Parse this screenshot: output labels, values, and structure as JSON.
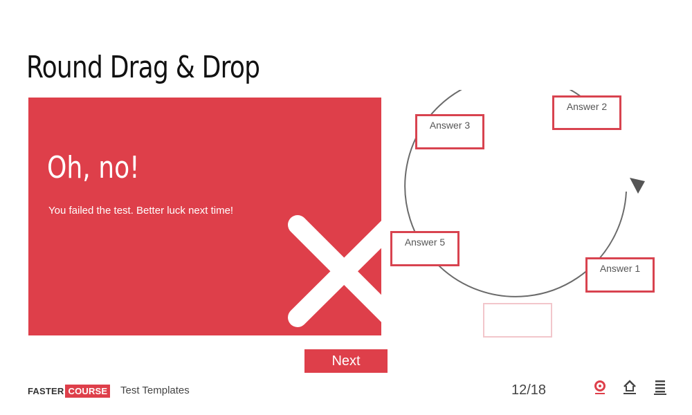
{
  "page": {
    "title": "Round Drag & Drop"
  },
  "feedback": {
    "heading": "Oh, no!",
    "message": "You failed the test. Better luck next time!"
  },
  "next_button": {
    "label": "Next"
  },
  "answers": {
    "answer_1": "Answer 1",
    "answer_2": "Answer 2",
    "answer_3": "Answer 3",
    "answer_5": "Answer 5"
  },
  "footer": {
    "logo_left": "FASTER",
    "logo_right": "COURSE",
    "course_title": "Test Templates",
    "page_counter": "12/18",
    "icons": [
      "help-icon",
      "home-icon",
      "menu-icon"
    ]
  },
  "colors": {
    "accent": "#de3f4a",
    "box_border": "#d8434f",
    "drop_zone_border": "#f2c6cb",
    "cycle_stroke": "#6a6a6a"
  }
}
